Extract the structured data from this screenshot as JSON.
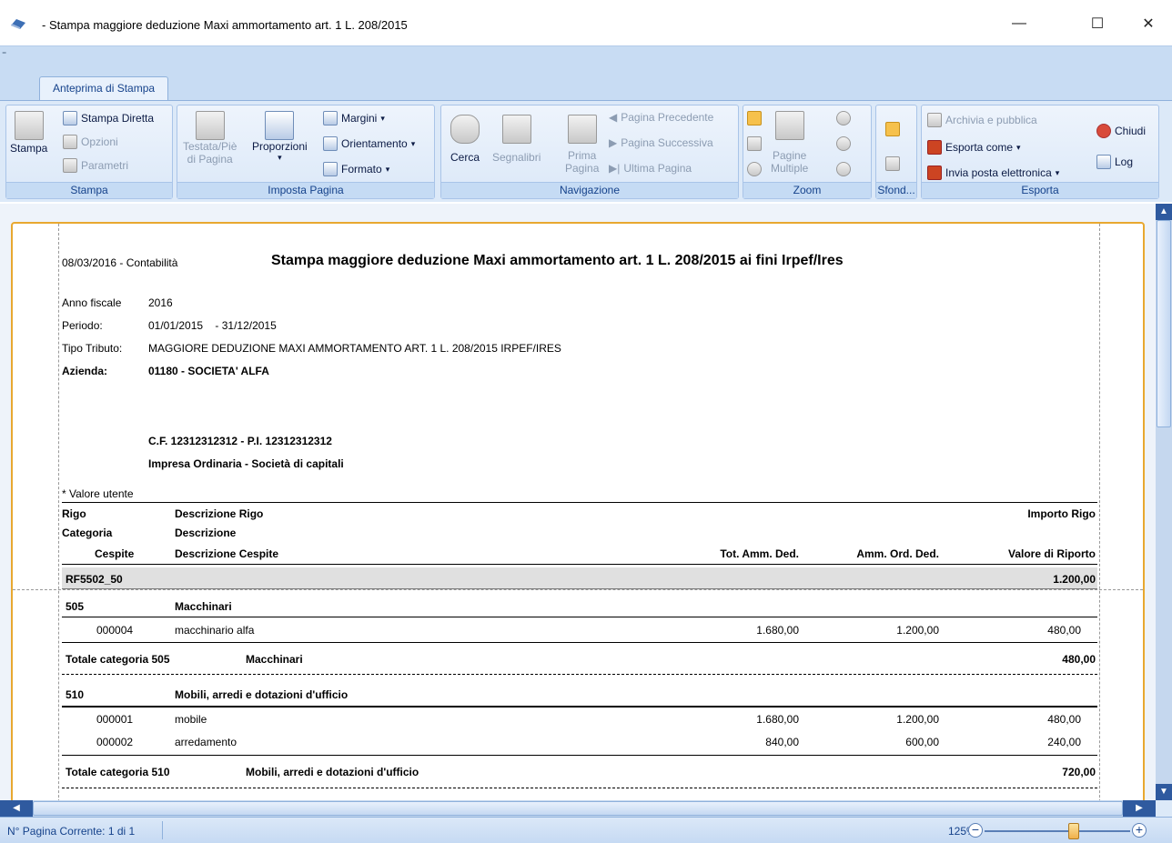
{
  "window": {
    "title": "- Stampa maggiore deduzione Maxi ammortamento art. 1 L. 208/2015",
    "minimize": "—",
    "maximize": "☐",
    "close": "✕"
  },
  "ribbon": {
    "tab": "Anteprima di Stampa",
    "groups": {
      "stampa": {
        "label": "Stampa",
        "print": "Stampa",
        "direct": "Stampa Diretta",
        "options": "Opzioni",
        "params": "Parametri"
      },
      "imposta": {
        "label": "Imposta Pagina",
        "header_footer_1": "Testata/Piè",
        "header_footer_2": "di Pagina",
        "proportions": "Proporzioni",
        "margins": "Margini",
        "orientation": "Orientamento",
        "format": "Formato"
      },
      "nav": {
        "label": "Navigazione",
        "search": "Cerca",
        "bookmarks": "Segnalibri",
        "first_1": "Prima",
        "first_2": "Pagina",
        "prev": "Pagina Precedente",
        "next": "Pagina Successiva",
        "last": "Ultima Pagina"
      },
      "zoom": {
        "label": "Zoom",
        "multi_1": "Pagine",
        "multi_2": "Multiple"
      },
      "sfondo": {
        "label": "Sfond..."
      },
      "esporta": {
        "label": "Esporta",
        "archive": "Archivia e pubblica",
        "export": "Esporta come",
        "email": "Invia posta elettronica",
        "close": "Chiudi",
        "log": "Log"
      }
    }
  },
  "report": {
    "date_line": "08/03/2016 - Contabilità",
    "title": "Stampa maggiore deduzione Maxi ammortamento art. 1 L. 208/2015 ai fini Irpef/Ires",
    "fields": [
      {
        "label": "Anno fiscale",
        "value": "2016"
      },
      {
        "label": "Periodo:",
        "value": "01/01/2015    - 31/12/2015"
      },
      {
        "label": "Tipo Tributo:",
        "value": "MAGGIORE DEDUZIONE MAXI AMMORTAMENTO ART. 1 L. 208/2015 IRPEF/IRES"
      },
      {
        "label": "Azienda:",
        "value": "01180 - SOCIETA' ALFA"
      }
    ],
    "cf_line": "C.F. 12312312312 - P.I. 12312312312",
    "company_type": "Impresa Ordinaria - Società di capitali",
    "note": "* Valore utente",
    "headers": {
      "rigo": "Rigo",
      "desc_rigo": "Descrizione Rigo",
      "importo_rigo": "Importo Rigo",
      "categoria": "Categoria",
      "descrizione": "Descrizione",
      "cespite": "Cespite",
      "desc_cespite": "Descrizione Cespite",
      "tot_amm": "Tot. Amm. Ded.",
      "amm_ord": "Amm. Ord. Ded.",
      "valore_riporto": "Valore di Riporto"
    },
    "rigo": {
      "code": "RF5502_50",
      "amount": "1.200,00"
    },
    "categories": [
      {
        "code": "505",
        "name": "Macchinari",
        "items": [
          {
            "id": "000004",
            "desc": "macchinario alfa",
            "tot": "1.680,00",
            "ord": "1.200,00",
            "val": "480,00"
          }
        ],
        "total_label": "Totale categoria 505",
        "total_name": "Macchinari",
        "total": "480,00"
      },
      {
        "code": "510",
        "name": "Mobili, arredi e dotazioni d'ufficio",
        "items": [
          {
            "id": "000001",
            "desc": "mobile",
            "tot": "1.680,00",
            "ord": "1.200,00",
            "val": "480,00"
          },
          {
            "id": "000002",
            "desc": "arredamento",
            "tot": "840,00",
            "ord": "600,00",
            "val": "240,00"
          }
        ],
        "total_label": "Totale categoria 510",
        "total_name": "Mobili, arredi e dotazioni d'ufficio",
        "total": "720,00"
      }
    ]
  },
  "status": {
    "page": "N° Pagina Corrente: 1 di 1",
    "zoom": "125%",
    "zoom_percent": 125
  }
}
